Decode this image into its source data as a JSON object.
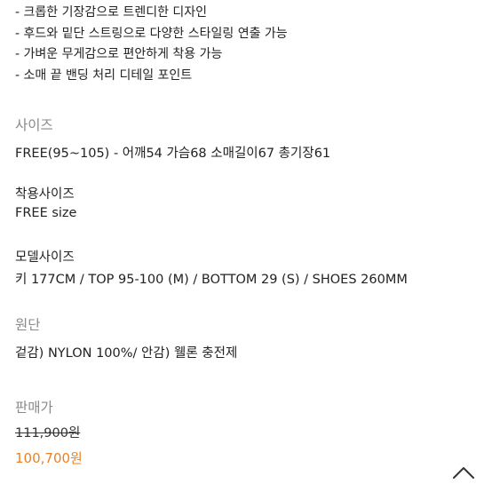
{
  "features": [
    "- 크롭한 기장감으로 트렌디한 디자인",
    "- 후드와 밑단 스트링으로 다양한 스타일링 연출 가능",
    "- 가벼운 무게감으로 편안하게 착용 가능",
    "- 소매 끝 밴딩 처리 디테일 포인트"
  ],
  "size": {
    "label": "사이즈",
    "value": "FREE(95~105) - 어깨54 가슴68 소매길이67 총기장61"
  },
  "worn_size": {
    "label": "착용사이즈",
    "value": "FREE size"
  },
  "model_size": {
    "label": "모델사이즈",
    "value": "키 177CM / TOP 95-100 (M) / BOTTOM 29 (S) / SHOES 260MM"
  },
  "fabric": {
    "label": "원단",
    "value": "겉감) NYLON 100%/ 안감) 웰론 충전제"
  },
  "price": {
    "label": "판매가",
    "original": "111,900원",
    "sale": "100,700원"
  },
  "icons": {
    "scroll_top": "chevron-up-icon"
  },
  "colors": {
    "sale_price": "#ef7f22",
    "section_heading": "#8a8a8a",
    "text": "#222222"
  }
}
